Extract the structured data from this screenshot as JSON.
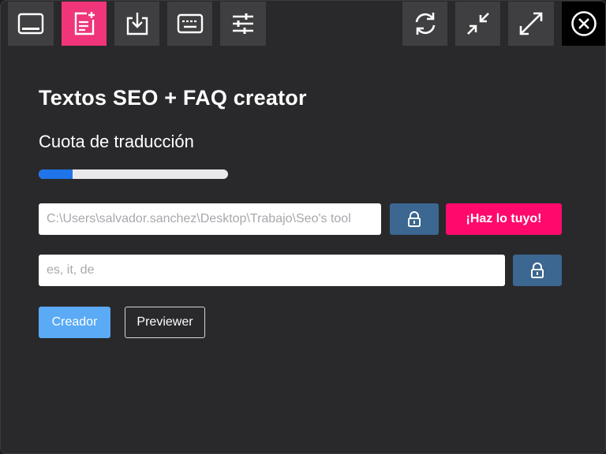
{
  "toolbar": {
    "left_icons": [
      "window-icon",
      "new-document-icon",
      "download-icon",
      "keyboard-icon",
      "sliders-icon"
    ],
    "right_icons": [
      "refresh-icon",
      "minimize-icon",
      "maximize-icon",
      "close-icon"
    ]
  },
  "main": {
    "title": "Textos SEO + FAQ creator",
    "quota_label": "Cuota de traducción",
    "quota_progress": 0.18
  },
  "path_field": {
    "value": "C:\\Users\\salvador.sanchez\\Desktop\\Trabajo\\Seo's tool"
  },
  "cta": {
    "label": "¡Haz lo tuyo!"
  },
  "languages_field": {
    "placeholder": "es, it, de"
  },
  "actions": {
    "creator_label": "Creador",
    "previewer_label": "Previewer"
  },
  "colors": {
    "accent": "#ff0a6c",
    "lock_button": "#3b6791",
    "primary_button": "#5aaaf5",
    "progress": "#1e74e8"
  }
}
